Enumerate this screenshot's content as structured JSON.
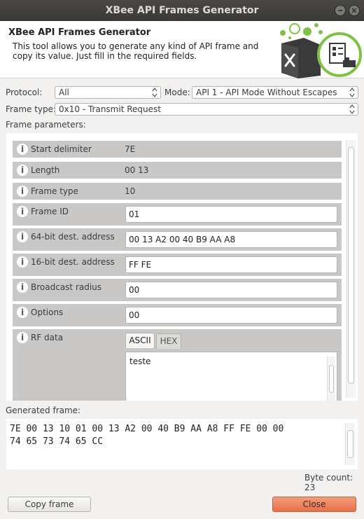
{
  "window": {
    "title": "XBee API Frames Generator"
  },
  "header": {
    "title": "XBee API Frames Generator",
    "description": "This tool allows you to generate any kind of API frame and copy its value. Just fill in the required fields."
  },
  "protocol": {
    "label": "Protocol:",
    "value": "All"
  },
  "mode": {
    "label": "Mode:",
    "value": "API 1 - API Mode Without Escapes"
  },
  "frame_type": {
    "label": "Frame type:",
    "value": "0x10 - Transmit Request"
  },
  "frame_params": {
    "label": "Frame parameters:",
    "start_delimiter": {
      "name": "Start delimiter",
      "value": "7E"
    },
    "length": {
      "name": "Length",
      "value": "00 13"
    },
    "frame_type": {
      "name": "Frame type",
      "value": "10"
    },
    "frame_id": {
      "name": "Frame ID",
      "value": "01"
    },
    "dest64": {
      "name": "64-bit dest. address",
      "value": "00 13 A2 00 40 B9 AA A8"
    },
    "dest16": {
      "name": "16-bit dest. address",
      "value": "FF FE"
    },
    "broadcast_radius": {
      "name": "Broadcast radius",
      "value": "00"
    },
    "options": {
      "name": "Options",
      "value": "00"
    },
    "rf_data": {
      "name": "RF data",
      "tabs": [
        "ASCII",
        "HEX"
      ],
      "active_tab": "ASCII",
      "value": "teste"
    }
  },
  "generated": {
    "label": "Generated frame:",
    "value": "7E 00 13 10 01 00 13 A2 00 40 B9 AA A8 FF FE 00 00\n74 65 73 74 65 CC",
    "byte_count": "Byte count: 23"
  },
  "buttons": {
    "copy": "Copy frame",
    "close": "Close"
  },
  "colors": {
    "close_button": "#e8714b",
    "logo_green": "#7dc242",
    "logo_dark": "#3a3a3a"
  },
  "icons": [
    "info-icon",
    "xbee-logo",
    "minimize-icon",
    "close-icon"
  ]
}
